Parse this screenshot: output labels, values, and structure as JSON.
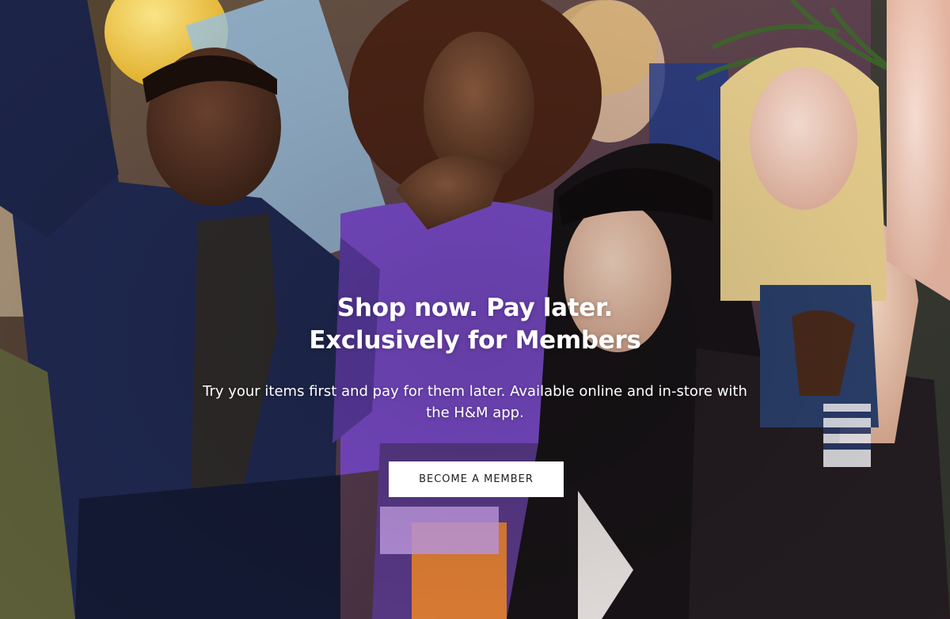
{
  "hero": {
    "headline_line1": "Shop now. Pay later.",
    "headline_line2": "Exclusively for Members",
    "subtext": "Try your items first and pay for them later. Available online and in-store with the H&M app.",
    "cta_label": "BECOME A MEMBER"
  },
  "colors": {
    "text": "#ffffff",
    "button_bg": "#ffffff",
    "button_text": "#222222"
  }
}
